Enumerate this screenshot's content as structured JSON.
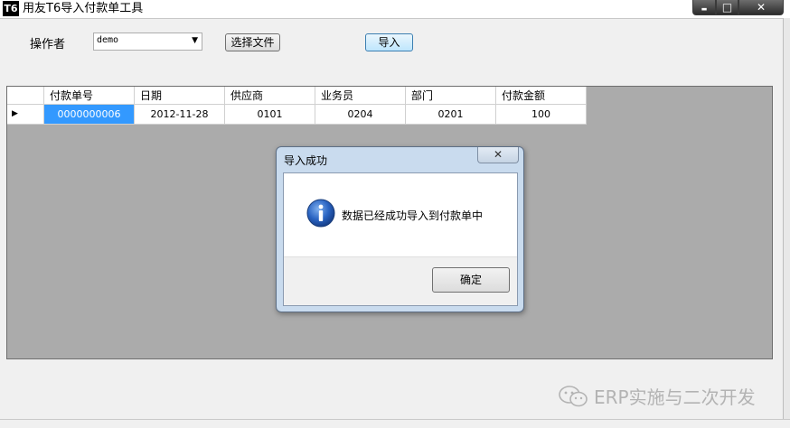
{
  "window": {
    "logo": "T6",
    "title": "用友T6导入付款单工具",
    "minimize": "▬",
    "maximize": "□",
    "close": "✕"
  },
  "toolbar": {
    "operator_label": "操作者",
    "operator_value": "demo",
    "select_file_label": "选择文件",
    "import_label": "导入"
  },
  "grid": {
    "columns": [
      "付款单号",
      "日期",
      "供应商",
      "业务员",
      "部门",
      "付款金额"
    ],
    "rows": [
      {
        "indicator": "▶",
        "cells": [
          "0000000006",
          "2012-11-28",
          "0101",
          "0204",
          "0201",
          "100"
        ]
      }
    ]
  },
  "dialog": {
    "title": "导入成功",
    "close_label": "✕",
    "message": "数据已经成功导入到付款单中",
    "ok_label": "确定",
    "icon": "info-icon"
  },
  "watermark": {
    "text": "ERP实施与二次开发",
    "icon": "wechat-icon"
  }
}
